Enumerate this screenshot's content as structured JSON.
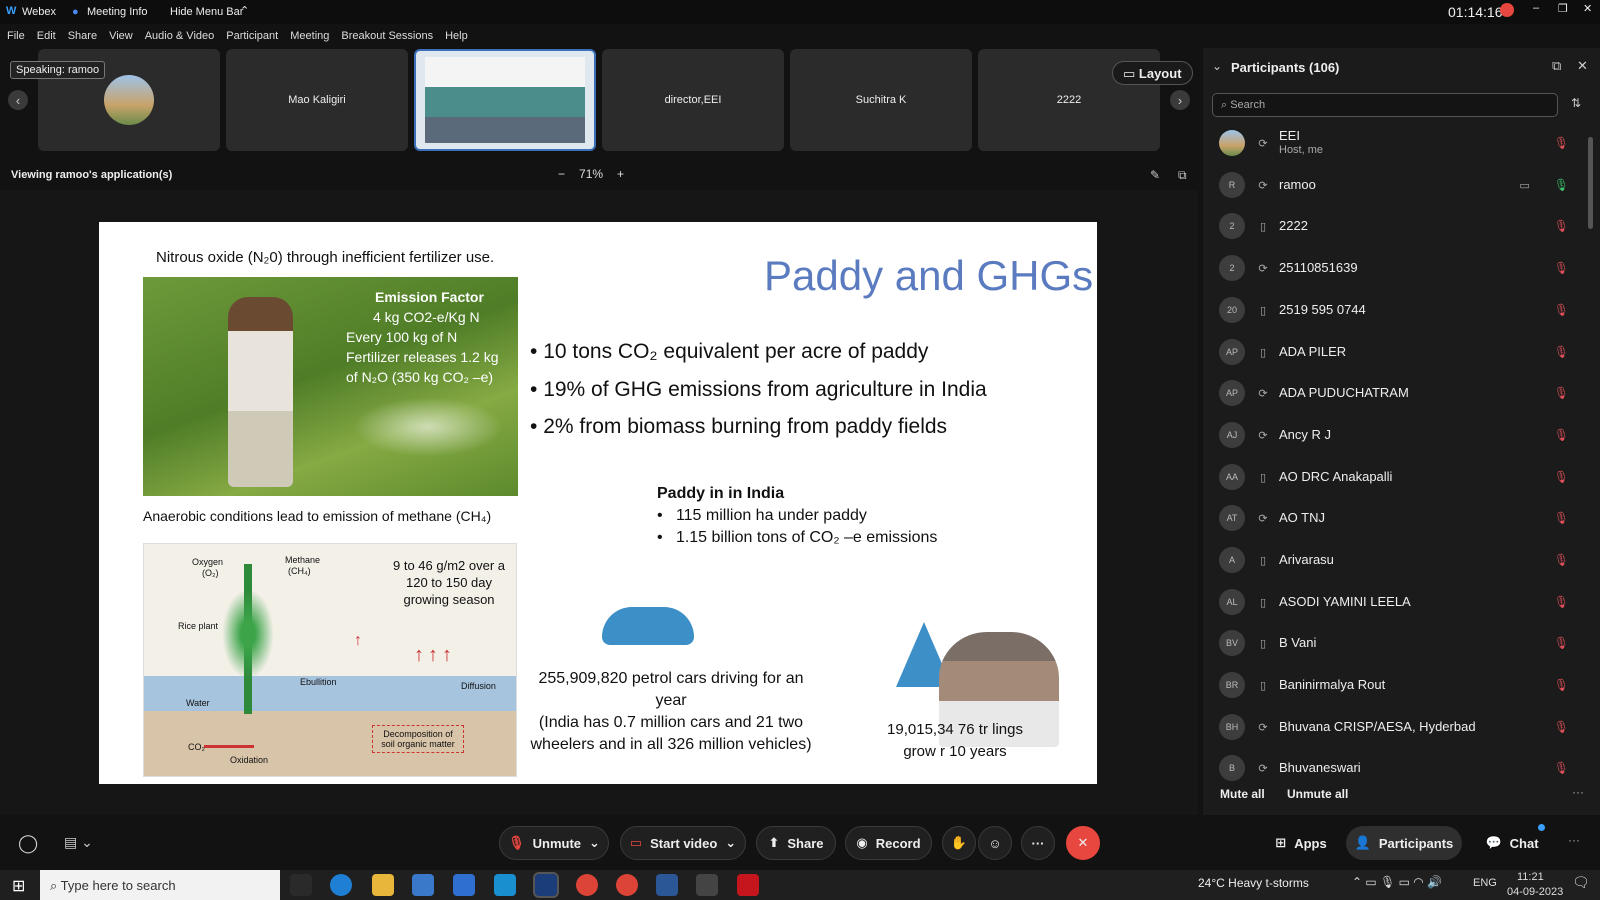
{
  "titlebar": {
    "app": "Webex",
    "meeting_info": "Meeting Info",
    "hide_menu": "Hide Menu Bar",
    "timer": "01:14:16"
  },
  "menu": [
    "File",
    "Edit",
    "Share",
    "View",
    "Audio & Video",
    "Participant",
    "Meeting",
    "Breakout Sessions",
    "Help"
  ],
  "speaking": "Speaking: ramoo",
  "thumbs": [
    "Mao Kaligiri",
    "director,EEI",
    "Suchitra K",
    "2222"
  ],
  "layout_label": "Layout",
  "viewing": "Viewing ramoo's application(s)",
  "zoom": "71%",
  "slide": {
    "line1": "Nitrous oxide (N₂0) through inefficient fertilizer use.",
    "title": "Paddy and GHGs",
    "ef_title": "Emission Factor",
    "ef_1": "4 kg CO2-e/Kg N",
    "ef_2": "Every 100 kg of N",
    "ef_3": "Fertilizer releases 1.2 kg",
    "ef_4": "of N₂O (350 kg CO₂ –e)",
    "b1": "10 tons CO₂ equivalent per acre of paddy",
    "b2": "19% of GHG emissions from agriculture in India",
    "b3": "2% from biomass burning from paddy fields",
    "anaerobic": "Anaerobic conditions lead to emission of methane (CH₄)",
    "india_h": "Paddy in in India",
    "india_1": "115 million ha under paddy",
    "india_2": "1.15 billion tons of CO₂ –e emissions",
    "diag_season_1": "9 to 46 g/m2 over a",
    "diag_season_2": "120 to 150 day",
    "diag_season_3": "growing season",
    "diag_oxygen": "Oxygen",
    "diag_o2": "(O₂)",
    "diag_methane": "Methane",
    "diag_ch4": "(CH₄)",
    "diag_rice": "Rice plant",
    "diag_ebull": "Ebullition",
    "diag_diff": "Diffusion",
    "diag_water": "Water",
    "diag_oxid": "Oxidation",
    "diag_co2": "CO₂",
    "diag_decomp": "Decomposition of soil organic matter",
    "cars_1": "255,909,820 petrol cars driving for an",
    "cars_2": "year",
    "cars_3": "(India has 0.7 million cars and 21 two",
    "cars_4": "wheelers and in all 326 million vehicles)",
    "trees_1": "19,015,34   76 tr   lings",
    "trees_2": "grow    r 10 years"
  },
  "panel": {
    "title": "Participants (106)",
    "search_placeholder": "Search",
    "mute_all": "Mute all",
    "unmute_all": "Unmute all"
  },
  "participants": [
    {
      "initials": "",
      "name": "EEI",
      "sub": "Host, me",
      "device": "⟳"
    },
    {
      "initials": "R",
      "name": "ramoo",
      "sub": "",
      "device": "⟳"
    },
    {
      "initials": "2",
      "name": "2222",
      "sub": "",
      "device": "▯"
    },
    {
      "initials": "2",
      "name": "25110851639",
      "sub": "",
      "device": "⟳"
    },
    {
      "initials": "20",
      "name": "2519 595 0744",
      "sub": "",
      "device": "▯"
    },
    {
      "initials": "AP",
      "name": "ADA PILER",
      "sub": "",
      "device": "▯"
    },
    {
      "initials": "AP",
      "name": "ADA PUDUCHATRAM",
      "sub": "",
      "device": "⟳"
    },
    {
      "initials": "AJ",
      "name": "Ancy R J",
      "sub": "",
      "device": "⟳"
    },
    {
      "initials": "AA",
      "name": "AO DRC Anakapalli",
      "sub": "",
      "device": "▯"
    },
    {
      "initials": "AT",
      "name": "AO TNJ",
      "sub": "",
      "device": "⟳"
    },
    {
      "initials": "A",
      "name": "Arivarasu",
      "sub": "",
      "device": "▯"
    },
    {
      "initials": "AL",
      "name": "ASODI YAMINI LEELA",
      "sub": "",
      "device": "▯"
    },
    {
      "initials": "BV",
      "name": "B Vani",
      "sub": "",
      "device": "▯"
    },
    {
      "initials": "BR",
      "name": "Baninirmalya Rout",
      "sub": "",
      "device": "▯"
    },
    {
      "initials": "BH",
      "name": "Bhuvana CRISP/AESA, Hyderbad",
      "sub": "",
      "device": "⟳"
    },
    {
      "initials": "B",
      "name": "Bhuvaneswari",
      "sub": "",
      "device": "⟳"
    }
  ],
  "controls": {
    "unmute": "Unmute",
    "start_video": "Start video",
    "share": "Share",
    "record": "Record",
    "apps": "Apps",
    "participants": "Participants",
    "chat": "Chat"
  },
  "taskbar": {
    "search": "Type here to search",
    "weather": "24°C  Heavy t-storms",
    "lang": "ENG",
    "time": "11:21",
    "date": "04-09-2023"
  },
  "colors": {
    "accent": "#e8473f",
    "slide_title": "#5b7bc0",
    "panel_bg": "#1b1b1b"
  }
}
